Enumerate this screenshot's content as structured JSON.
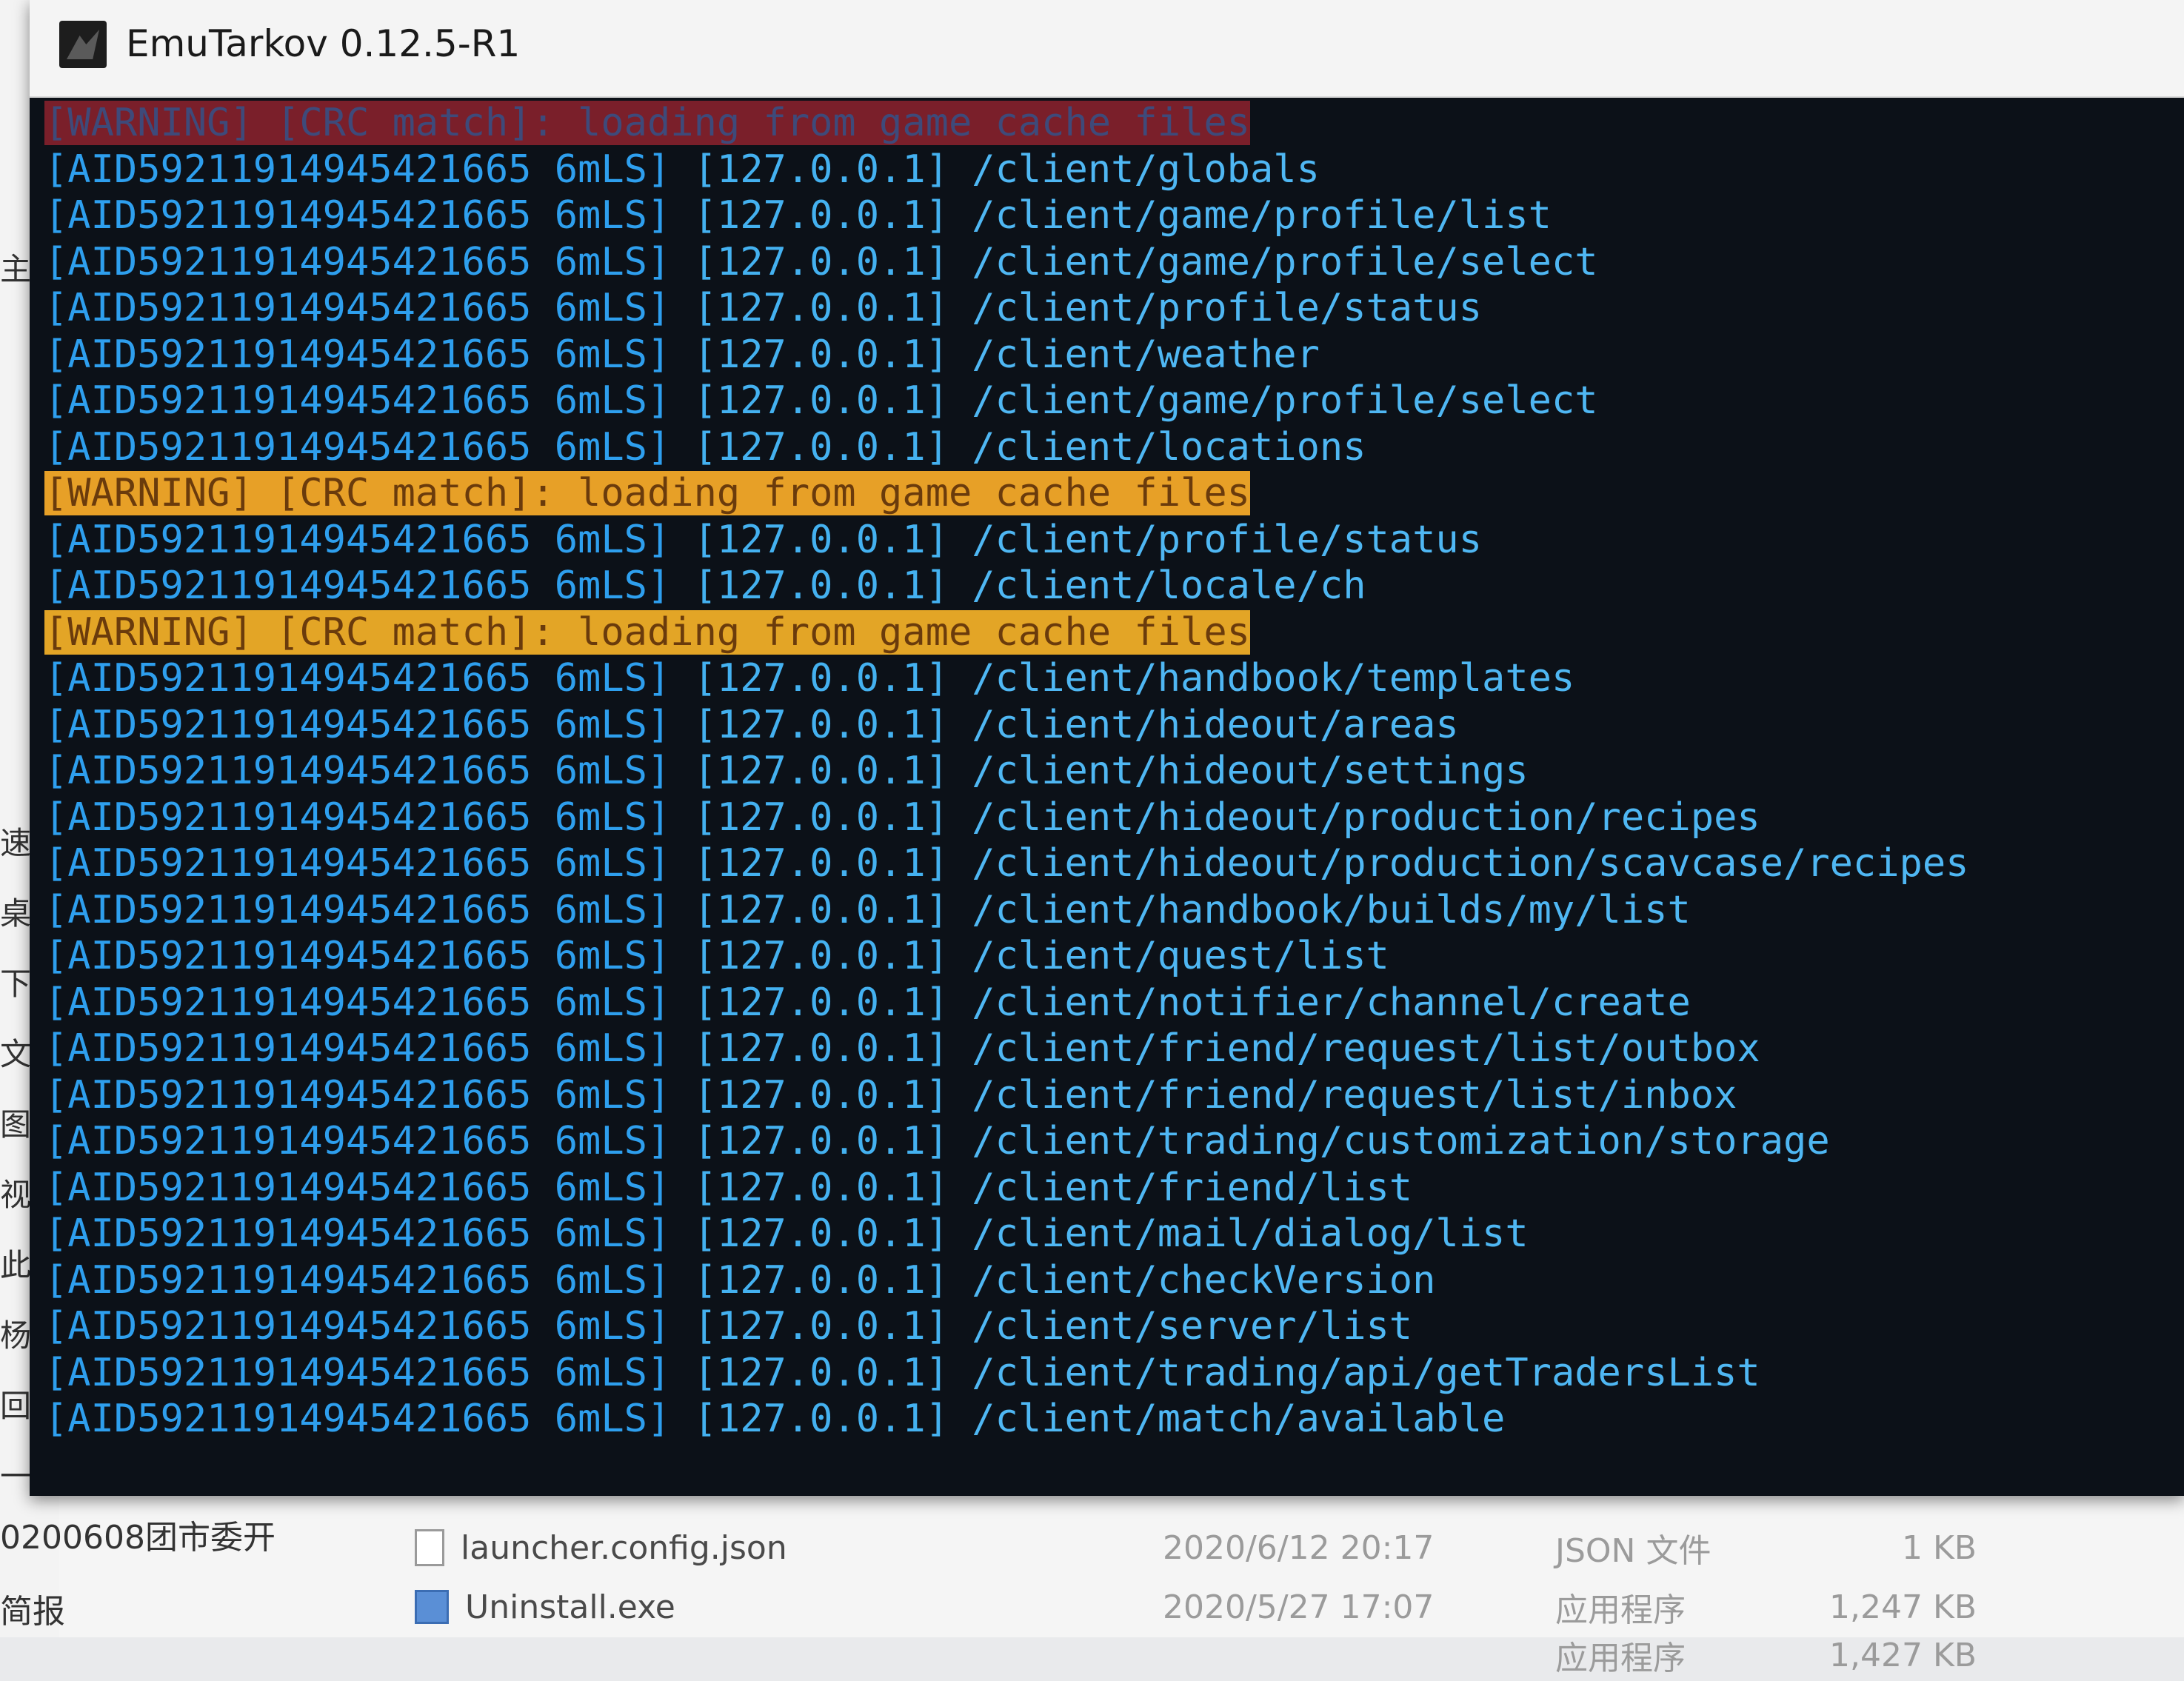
{
  "window": {
    "title": "EmuTarkov 0.12.5-R1"
  },
  "console": {
    "warning_text": "[WARNING] [CRC match]: loading from game cache files",
    "session_id": "[AID5921191494542166 56mLS]",
    "ip": "[127.0.0.1]",
    "lines": [
      {
        "type": "warning",
        "text": "[WARNING] [CRC match]: loading from game cache files",
        "highlight": "#7a1f2a"
      },
      {
        "type": "request",
        "session": "[AID59211914945421665 6mLS]",
        "ip": "[127.0.0.1]",
        "path": "/client/globals"
      },
      {
        "type": "request",
        "session": "[AID59211914945421665 6mLS]",
        "ip": "[127.0.0.1]",
        "path": "/client/game/profile/list"
      },
      {
        "type": "request",
        "session": "[AID59211914945421665 6mLS]",
        "ip": "[127.0.0.1]",
        "path": "/client/game/profile/select"
      },
      {
        "type": "request",
        "session": "[AID59211914945421665 6mLS]",
        "ip": "[127.0.0.1]",
        "path": "/client/profile/status"
      },
      {
        "type": "request",
        "session": "[AID59211914945421665 6mLS]",
        "ip": "[127.0.0.1]",
        "path": "/client/weather"
      },
      {
        "type": "request",
        "session": "[AID59211914945421665 6mLS]",
        "ip": "[127.0.0.1]",
        "path": "/client/game/profile/select"
      },
      {
        "type": "request",
        "session": "[AID59211914945421665 6mLS]",
        "ip": "[127.0.0.1]",
        "path": "/client/locations"
      },
      {
        "type": "warning",
        "text": "[WARNING] [CRC match]: loading from game cache files",
        "highlight": "#e7a027"
      },
      {
        "type": "request",
        "session": "[AID59211914945421665 6mLS]",
        "ip": "[127.0.0.1]",
        "path": "/client/profile/status"
      },
      {
        "type": "request",
        "session": "[AID59211914945421665 6mLS]",
        "ip": "[127.0.0.1]",
        "path": "/client/locale/ch"
      },
      {
        "type": "warning",
        "text": "[WARNING] [CRC match]: loading from game cache files",
        "highlight": "#e3a526"
      },
      {
        "type": "request",
        "session": "[AID59211914945421665 6mLS]",
        "ip": "[127.0.0.1]",
        "path": "/client/handbook/templates"
      },
      {
        "type": "request",
        "session": "[AID59211914945421665 6mLS]",
        "ip": "[127.0.0.1]",
        "path": "/client/hideout/areas"
      },
      {
        "type": "request",
        "session": "[AID59211914945421665 6mLS]",
        "ip": "[127.0.0.1]",
        "path": "/client/hideout/settings"
      },
      {
        "type": "request",
        "session": "[AID59211914945421665 6mLS]",
        "ip": "[127.0.0.1]",
        "path": "/client/hideout/production/recipes"
      },
      {
        "type": "request",
        "session": "[AID59211914945421665 6mLS]",
        "ip": "[127.0.0.1]",
        "path": "/client/hideout/production/scavcase/recipes"
      },
      {
        "type": "request",
        "session": "[AID59211914945421665 6mLS]",
        "ip": "[127.0.0.1]",
        "path": "/client/handbook/builds/my/list"
      },
      {
        "type": "request",
        "session": "[AID59211914945421665 6mLS]",
        "ip": "[127.0.0.1]",
        "path": "/client/quest/list"
      },
      {
        "type": "request",
        "session": "[AID59211914945421665 6mLS]",
        "ip": "[127.0.0.1]",
        "path": "/client/notifier/channel/create"
      },
      {
        "type": "request",
        "session": "[AID59211914945421665 6mLS]",
        "ip": "[127.0.0.1]",
        "path": "/client/friend/request/list/outbox"
      },
      {
        "type": "request",
        "session": "[AID59211914945421665 6mLS]",
        "ip": "[127.0.0.1]",
        "path": "/client/friend/request/list/inbox"
      },
      {
        "type": "request",
        "session": "[AID59211914945421665 6mLS]",
        "ip": "[127.0.0.1]",
        "path": "/client/trading/customization/storage"
      },
      {
        "type": "request",
        "session": "[AID59211914945421665 6mLS]",
        "ip": "[127.0.0.1]",
        "path": "/client/friend/list"
      },
      {
        "type": "request",
        "session": "[AID59211914945421665 6mLS]",
        "ip": "[127.0.0.1]",
        "path": "/client/mail/dialog/list"
      },
      {
        "type": "request",
        "session": "[AID59211914945421665 6mLS]",
        "ip": "[127.0.0.1]",
        "path": "/client/checkVersion"
      },
      {
        "type": "request",
        "session": "[AID59211914945421665 6mLS]",
        "ip": "[127.0.0.1]",
        "path": "/client/server/list"
      },
      {
        "type": "request",
        "session": "[AID59211914945421665 6mLS]",
        "ip": "[127.0.0.1]",
        "path": "/client/trading/api/getTradersList"
      },
      {
        "type": "request",
        "session": "[AID59211914945421665 6mLS]",
        "ip": "[127.0.0.1]",
        "path": "/client/match/available"
      }
    ]
  },
  "explorer": {
    "sidebar_labels": [
      "主",
      "速访",
      "桌面",
      "下载",
      "文档",
      "图片",
      "视频",
      "此电",
      "杨鑫",
      "回收",
      "一定"
    ],
    "bottom_left_text": "0200608团市委开",
    "bottom_left_text2": "简报",
    "files": [
      {
        "name": "launcher.config.json",
        "date": "2020/6/12 20:17",
        "type": "JSON 文件",
        "size": "1 KB",
        "icon": "file-icon"
      },
      {
        "name": "Uninstall.exe",
        "date": "2020/5/27 17:07",
        "type": "应用程序",
        "size": "1,247 KB",
        "icon": "exe-icon"
      },
      {
        "name": "",
        "date": "",
        "type": "应用程序",
        "size": "1,427 KB",
        "icon": "exe-icon"
      }
    ]
  },
  "colors": {
    "console_bg": "#0c1118",
    "console_text": "#2c97e6",
    "warn_red": "#7a1f2a",
    "warn_orange": "#e7a027",
    "warn_yellow": "#e3a526"
  }
}
